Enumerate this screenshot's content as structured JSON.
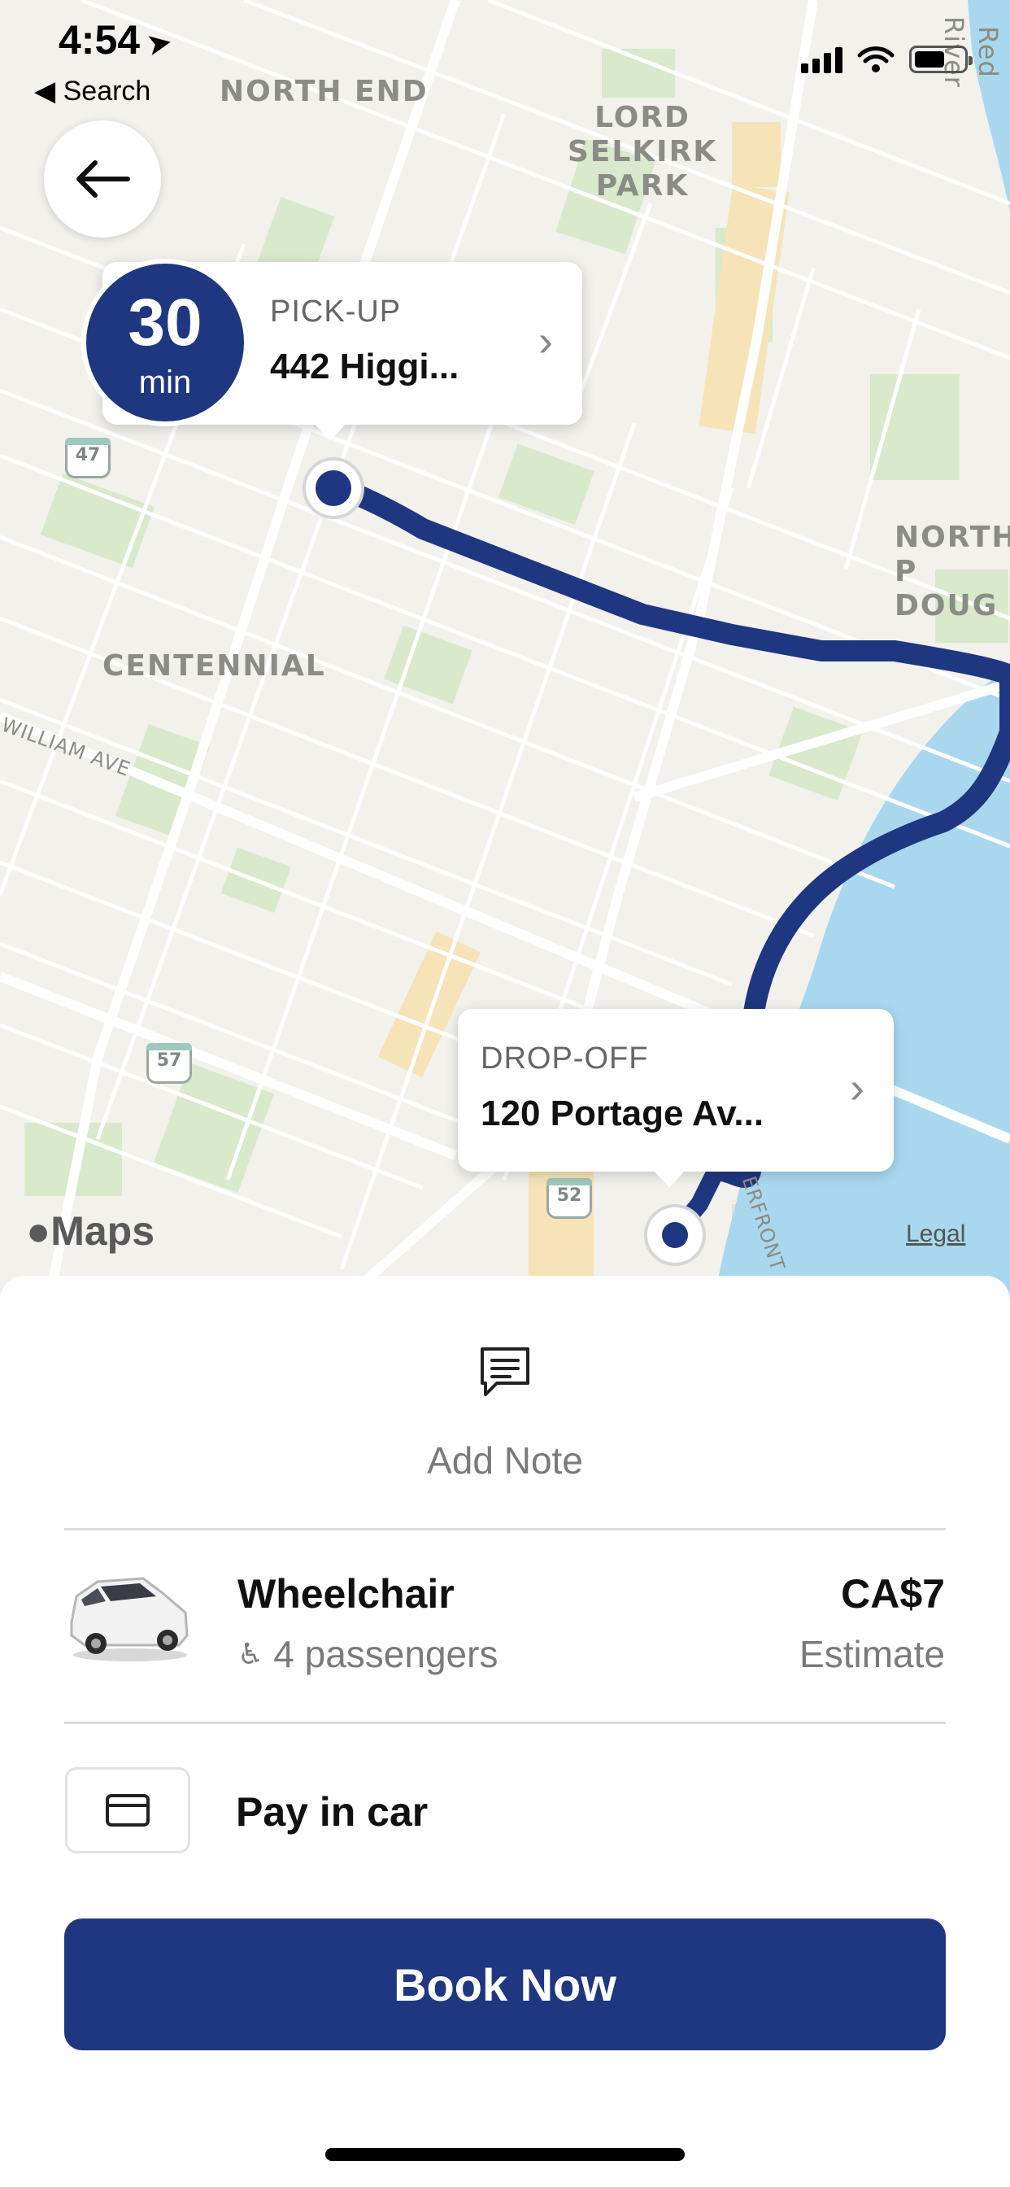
{
  "status_bar": {
    "time": "4:54",
    "back_app": "Search"
  },
  "map": {
    "labels": {
      "north_end": "NORTH END",
      "lord_selkirk": "LORD SELKIRK\nPARK",
      "red_river": "Red River",
      "north_doug": "NORTH P\nDOUG",
      "centennial": "CENTENNIAL",
      "william_ave": "WILLIAM AVE",
      "waterfront": "ERFRONT"
    },
    "shields": {
      "a": "47",
      "b": "57",
      "c": "52"
    },
    "route_color": "#1f3680",
    "attribution": "Maps",
    "legal": "Legal"
  },
  "pickup": {
    "eta_value": "30",
    "eta_unit": "min",
    "kicker": "PICK-UP",
    "address": "442 Higgi..."
  },
  "dropoff": {
    "kicker": "DROP-OFF",
    "address": "120 Portage Av..."
  },
  "sheet": {
    "add_note": "Add Note",
    "ride": {
      "name": "Wheelchair",
      "passengers": "4 passengers",
      "price": "CA$7",
      "price_note": "Estimate"
    },
    "payment": "Pay in car",
    "book_button": "Book Now"
  },
  "colors": {
    "accent": "#1f3680",
    "water": "#a9d8ee",
    "park": "#d6e8c8"
  }
}
